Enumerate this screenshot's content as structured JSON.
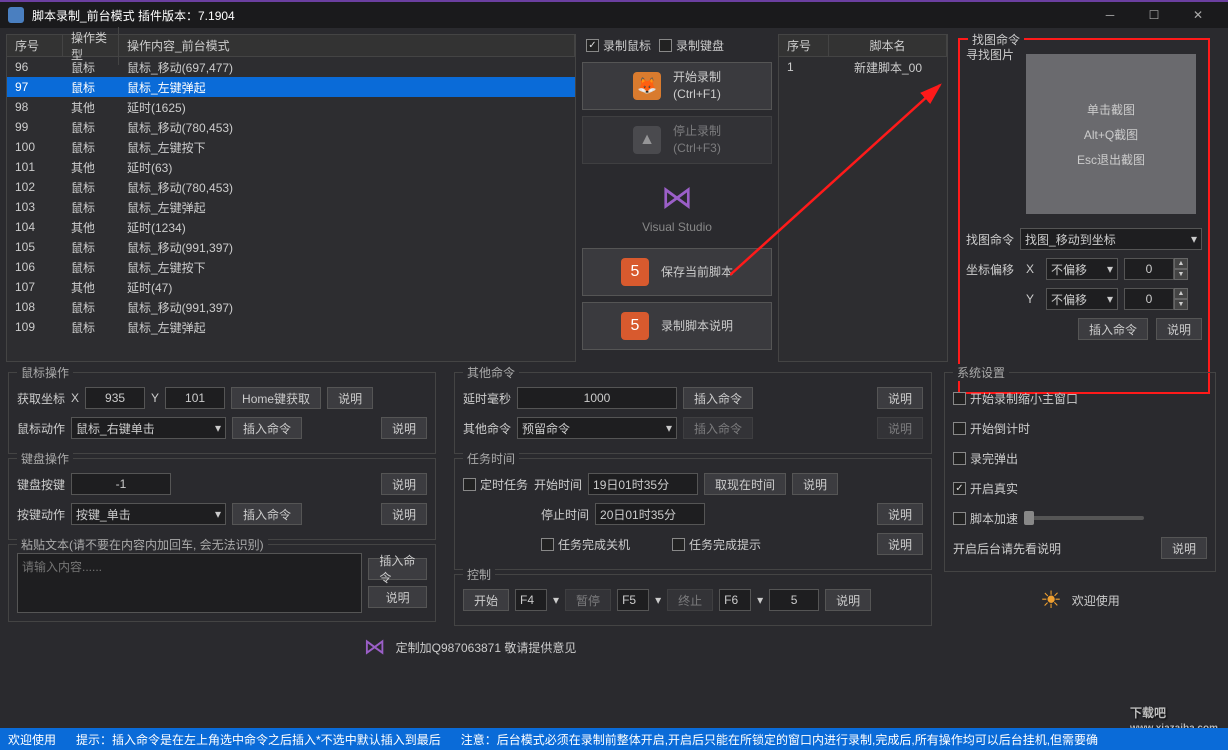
{
  "title": "脚本录制_前台模式  插件版本：7.1904",
  "gridHeaders": {
    "seq": "序号",
    "type": "操作类型",
    "content": "操作内容_前台模式"
  },
  "rows": [
    {
      "seq": "96",
      "type": "鼠标",
      "content": "鼠标_移动(697,477)"
    },
    {
      "seq": "97",
      "type": "鼠标",
      "content": "鼠标_左键弹起",
      "selected": true
    },
    {
      "seq": "98",
      "type": "其他",
      "content": "延时(1625)"
    },
    {
      "seq": "99",
      "type": "鼠标",
      "content": "鼠标_移动(780,453)"
    },
    {
      "seq": "100",
      "type": "鼠标",
      "content": "鼠标_左键按下"
    },
    {
      "seq": "101",
      "type": "其他",
      "content": "延时(63)"
    },
    {
      "seq": "102",
      "type": "鼠标",
      "content": "鼠标_移动(780,453)"
    },
    {
      "seq": "103",
      "type": "鼠标",
      "content": "鼠标_左键弹起"
    },
    {
      "seq": "104",
      "type": "其他",
      "content": "延时(1234)"
    },
    {
      "seq": "105",
      "type": "鼠标",
      "content": "鼠标_移动(991,397)"
    },
    {
      "seq": "106",
      "type": "鼠标",
      "content": "鼠标_左键按下"
    },
    {
      "seq": "107",
      "type": "其他",
      "content": "延时(47)"
    },
    {
      "seq": "108",
      "type": "鼠标",
      "content": "鼠标_移动(991,397)"
    },
    {
      "seq": "109",
      "type": "鼠标",
      "content": "鼠标_左键弹起"
    }
  ],
  "recordMouse": "录制鼠标",
  "recordKeyboard": "录制键盘",
  "startRecord": "开始录制",
  "startRecordKey": "(Ctrl+F1)",
  "stopRecord": "停止录制",
  "stopRecordKey": "(Ctrl+F3)",
  "vsLabel": "Visual Studio",
  "saveScript": "保存当前脚本",
  "scriptHelp": "录制脚本说明",
  "scriptHeaders": {
    "seq": "序号",
    "name": "脚本名"
  },
  "scripts": [
    {
      "seq": "1",
      "name": "新建脚本_00"
    }
  ],
  "mousePanel": {
    "title": "鼠标操作",
    "getCoord": "获取坐标",
    "x": "X",
    "xv": "935",
    "y": "Y",
    "yv": "101",
    "home": "Home键获取",
    "help": "说明",
    "action": "鼠标动作",
    "actionV": "鼠标_右键单击",
    "insert": "插入命令"
  },
  "keyPanel": {
    "title": "键盘操作",
    "key": "键盘按键",
    "keyV": "-1",
    "help": "说明",
    "action": "按键动作",
    "actionV": "按键_单击",
    "insert": "插入命令"
  },
  "pastePanel": {
    "title": "粘贴文本(请不要在内容内加回车, 会无法识别)",
    "placeholder": "请输入内容......",
    "insert": "插入命令",
    "help": "说明"
  },
  "otherPanel": {
    "title": "其他命令",
    "delay": "延时毫秒",
    "delayV": "1000",
    "insert": "插入命令",
    "help": "说明",
    "cmd": "其他命令",
    "cmdV": "预留命令"
  },
  "taskPanel": {
    "title": "任务时间",
    "timed": "定时任务",
    "start": "开始时间",
    "startV": "19日01时35分",
    "getNow": "取现在时间",
    "help": "说明",
    "stop": "停止时间",
    "stopV": "20日01时35分",
    "shutdown": "任务完成关机",
    "notify": "任务完成提示"
  },
  "ctrlPanel": {
    "title": "控制",
    "start": "开始",
    "startK": "F4",
    "pause": "暂停",
    "pauseK": "F5",
    "stop": "终止",
    "stopK": "F6",
    "count": "5",
    "help": "说明"
  },
  "findImg": {
    "title": "找图命令",
    "search": "寻找图片",
    "click": "单击截图",
    "altq": "Alt+Q截图",
    "esc": "Esc退出截图",
    "cmd": "找图命令",
    "cmdV": "找图_移动到坐标",
    "offset": "坐标偏移",
    "x": "X",
    "xv": "不偏移",
    "xn": "0",
    "y": "Y",
    "yv": "不偏移",
    "yn": "0",
    "insert": "插入命令",
    "help": "说明"
  },
  "sysPanel": {
    "title": "系统设置",
    "minimize": "开始录制缩小主窗口",
    "countdown": "开始倒计时",
    "popup": "录完弹出",
    "real": "开启真实",
    "accel": "脚本加速",
    "bgHelp": "开启后台请先看说明",
    "help": "说明"
  },
  "welcome": "欢迎使用",
  "qq": "定制加Q987063871   敬请提供意见",
  "status": {
    "welcome": "欢迎使用",
    "tip1": "提示：插入命令是在左上角选中命令之后插入*不选中默认插入到最后",
    "tip2": "注意：后台模式必须在录制前整体开启,开启后只能在所锁定的窗口内进行录制,完成后,所有操作均可以后台挂机,但需要确"
  },
  "watermark": "下载吧",
  "watermarkUrl": "www.xiazaiba.com"
}
